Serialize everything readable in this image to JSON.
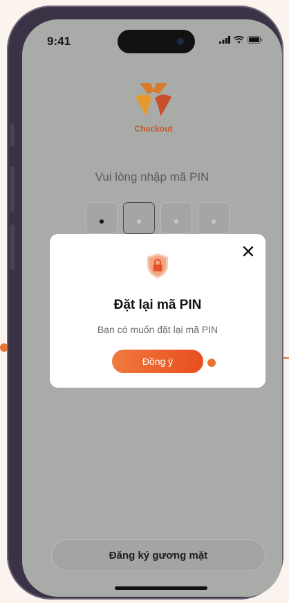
{
  "status_bar": {
    "time": "9:41"
  },
  "brand": {
    "name": "Checkout"
  },
  "pin_screen": {
    "prompt": "Vui lòng nhập mã PIN",
    "digits_filled": 1,
    "digits_total": 4
  },
  "modal": {
    "title": "Đặt lại mã PIN",
    "message": "Bạn có muốn đặt lại mã PIN",
    "confirm_label": "Đồng ý",
    "close_icon": "close-icon",
    "shield_icon": "shield-lock-icon"
  },
  "bottom_button": {
    "label": "Đăng ký gương mặt"
  },
  "colors": {
    "accent": "#e8722e",
    "brand": "#c8552c",
    "overlay_bg": "#a9aba8"
  }
}
